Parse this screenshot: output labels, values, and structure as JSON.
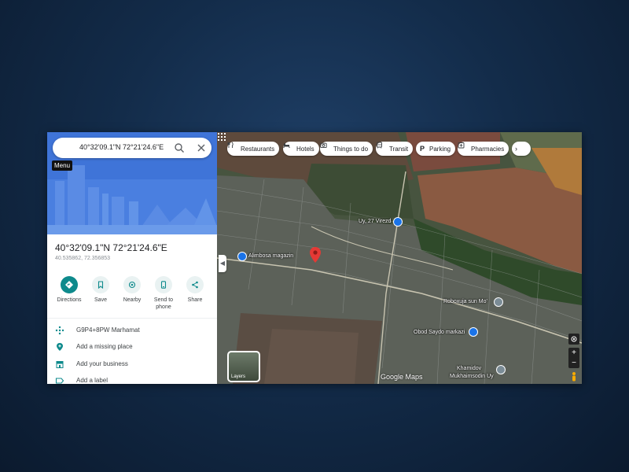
{
  "search": {
    "query": "40°32'09.1\"N 72°21'24.6\"E",
    "tooltip": "Menu"
  },
  "place": {
    "title": "40°32'09.1\"N 72°21'24.6\"E",
    "subtitle": "40.535862, 72.356853"
  },
  "actions": [
    {
      "label": "Directions",
      "icon": "directions-icon"
    },
    {
      "label": "Save",
      "icon": "bookmark-icon"
    },
    {
      "label": "Nearby",
      "icon": "nearby-icon"
    },
    {
      "label": "Send to phone",
      "icon": "phone-icon"
    },
    {
      "label": "Share",
      "icon": "share-icon"
    }
  ],
  "info_rows": [
    {
      "text": "G9P4+8PW Marhamat",
      "icon": "plus-code-icon"
    },
    {
      "text": "Add a missing place",
      "icon": "add-place-icon"
    },
    {
      "text": "Add your business",
      "icon": "business-icon"
    },
    {
      "text": "Add a label",
      "icon": "label-icon"
    }
  ],
  "chips": [
    {
      "label": "Restaurants",
      "icon": "restaurant-icon"
    },
    {
      "label": "Hotels",
      "icon": "hotel-icon"
    },
    {
      "label": "Things to do",
      "icon": "camera-icon"
    },
    {
      "label": "Transit",
      "icon": "transit-icon"
    },
    {
      "label": "Parking",
      "icon": "parking-icon"
    },
    {
      "label": "Pharmacies",
      "icon": "pharmacy-icon"
    }
  ],
  "map_labels": {
    "label_1": "Uy, 27 Virezd",
    "label_2": "Alimbosa magazin",
    "label_3": "Roboxuja sun Mo'",
    "label_4": "Obod Saydo markazi",
    "label_5": "Khamidov",
    "label_6": "Mukhaimsodin Uy"
  },
  "layers_label": "Layers",
  "branding": "Google Maps",
  "colors": {
    "accent": "#0e8a8c",
    "hero_blue": "#3f74d8",
    "pin": "#e53935",
    "poi_blue": "#1a73e8"
  }
}
